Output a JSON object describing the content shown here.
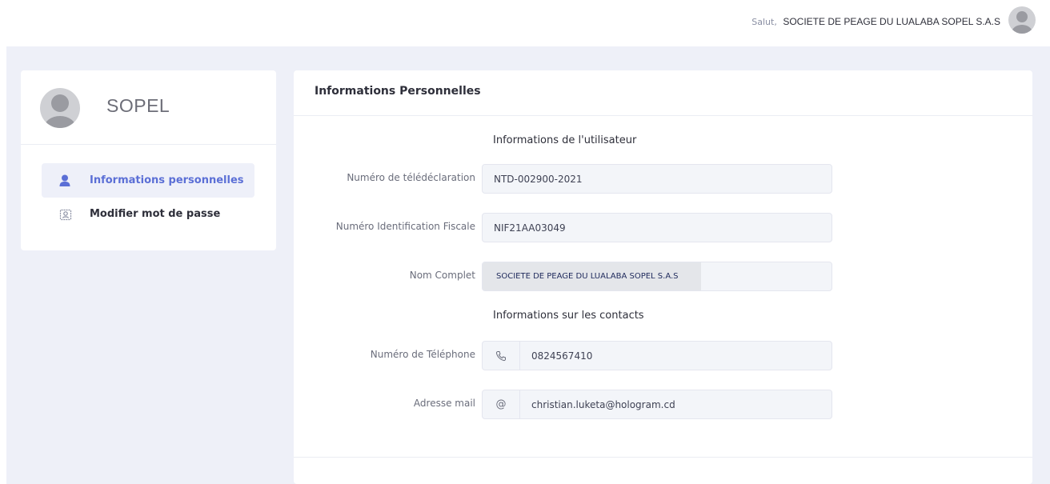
{
  "header": {
    "greeting_prefix": "Salut,",
    "user_name": "SOCIETE DE PEAGE DU LUALABA SOPEL S.A.S",
    "avatar_icon": "user-avatar-icon"
  },
  "sidebar": {
    "profile_name": "SOPEL",
    "items": [
      {
        "label": "Informations personnelles",
        "icon": "user-icon",
        "active": true
      },
      {
        "label": "Modifier mot de passe",
        "icon": "id-card-icon",
        "active": false
      }
    ]
  },
  "main": {
    "title": "Informations Personnelles",
    "section_user": "Informations de l'utilisateur",
    "section_contacts": "Informations sur les contacts",
    "fields": {
      "teledeclaration": {
        "label": "Numéro de télédéclaration",
        "value": "NTD-002900-2021"
      },
      "nif": {
        "label": "Numéro Identification Fiscale",
        "value": "NIF21AA03049"
      },
      "nom": {
        "label": "Nom Complet",
        "value": "SOCIETE DE PEAGE DU LUALABA SOPEL S.A.S"
      },
      "telephone": {
        "label": "Numéro de Téléphone",
        "value": "0824567410",
        "icon": "phone-icon"
      },
      "email": {
        "label": "Adresse mail",
        "value": "christian.luketa@hologram.cd",
        "icon": "at-icon",
        "icon_text": "@"
      }
    }
  },
  "colors": {
    "accent": "#5b6fd6",
    "background": "#eef0f8",
    "input_bg": "#f3f5f9"
  }
}
